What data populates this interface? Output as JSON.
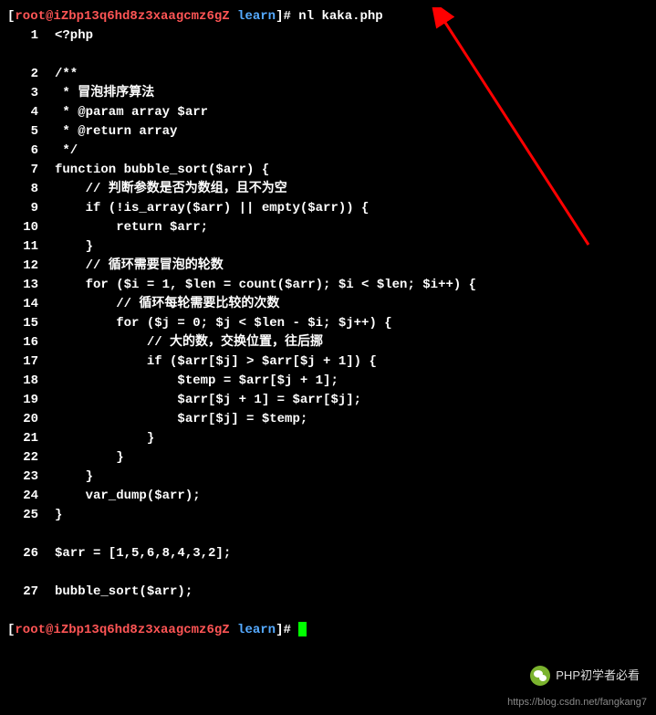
{
  "prompt1": {
    "bracket_open": "[",
    "user": "root@iZbp13q6hd8z3xaagcmz6gZ",
    "dir": " learn",
    "bracket_close": "]#",
    "command": " nl kaka.php"
  },
  "lines": [
    {
      "num": "1",
      "code": "<?php"
    },
    {
      "num": "",
      "code": ""
    },
    {
      "num": "2",
      "code": "/**"
    },
    {
      "num": "3",
      "code": " * 冒泡排序算法"
    },
    {
      "num": "4",
      "code": " * @param array $arr"
    },
    {
      "num": "5",
      "code": " * @return array"
    },
    {
      "num": "6",
      "code": " */"
    },
    {
      "num": "7",
      "code": "function bubble_sort($arr) {"
    },
    {
      "num": "8",
      "code": "    // 判断参数是否为数组，且不为空"
    },
    {
      "num": "9",
      "code": "    if (!is_array($arr) || empty($arr)) {"
    },
    {
      "num": "10",
      "code": "        return $arr;"
    },
    {
      "num": "11",
      "code": "    }"
    },
    {
      "num": "12",
      "code": "    // 循环需要冒泡的轮数"
    },
    {
      "num": "13",
      "code": "    for ($i = 1, $len = count($arr); $i < $len; $i++) {"
    },
    {
      "num": "14",
      "code": "        // 循环每轮需要比较的次数"
    },
    {
      "num": "15",
      "code": "        for ($j = 0; $j < $len - $i; $j++) {"
    },
    {
      "num": "16",
      "code": "            // 大的数，交换位置，往后挪"
    },
    {
      "num": "17",
      "code": "            if ($arr[$j] > $arr[$j + 1]) {"
    },
    {
      "num": "18",
      "code": "                $temp = $arr[$j + 1];"
    },
    {
      "num": "19",
      "code": "                $arr[$j + 1] = $arr[$j];"
    },
    {
      "num": "20",
      "code": "                $arr[$j] = $temp;"
    },
    {
      "num": "21",
      "code": "            }"
    },
    {
      "num": "22",
      "code": "        }"
    },
    {
      "num": "23",
      "code": "    }"
    },
    {
      "num": "24",
      "code": "    var_dump($arr);"
    },
    {
      "num": "25",
      "code": "}"
    },
    {
      "num": "",
      "code": ""
    },
    {
      "num": "26",
      "code": "$arr = [1,5,6,8,4,3,2];"
    },
    {
      "num": "",
      "code": ""
    },
    {
      "num": "27",
      "code": "bubble_sort($arr);"
    },
    {
      "num": "",
      "code": ""
    }
  ],
  "prompt2": {
    "bracket_open": "[",
    "user": "root@iZbp13q6hd8z3xaagcmz6gZ",
    "dir": " learn",
    "bracket_close": "]# "
  },
  "wechat_label": "PHP初学者必看",
  "watermark": "https://blog.csdn.net/fangkang7"
}
